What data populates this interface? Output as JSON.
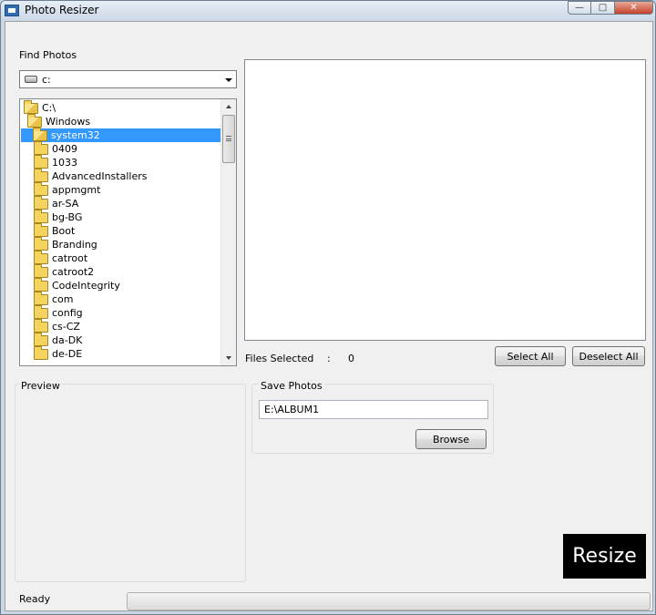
{
  "window": {
    "title": "Photo Resizer"
  },
  "find_photos": {
    "label": "Find Photos",
    "drive": "c:",
    "tree": [
      {
        "label": "C:\\",
        "level": 0,
        "open": true,
        "selected": false
      },
      {
        "label": "Windows",
        "level": 1,
        "open": true,
        "selected": false
      },
      {
        "label": "system32",
        "level": 2,
        "open": true,
        "selected": true
      },
      {
        "label": "0409",
        "level": 3,
        "open": false,
        "selected": false
      },
      {
        "label": "1033",
        "level": 3,
        "open": false,
        "selected": false
      },
      {
        "label": "AdvancedInstallers",
        "level": 3,
        "open": false,
        "selected": false
      },
      {
        "label": "appmgmt",
        "level": 3,
        "open": false,
        "selected": false
      },
      {
        "label": "ar-SA",
        "level": 3,
        "open": false,
        "selected": false
      },
      {
        "label": "bg-BG",
        "level": 3,
        "open": false,
        "selected": false
      },
      {
        "label": "Boot",
        "level": 3,
        "open": false,
        "selected": false
      },
      {
        "label": "Branding",
        "level": 3,
        "open": false,
        "selected": false
      },
      {
        "label": "catroot",
        "level": 3,
        "open": false,
        "selected": false
      },
      {
        "label": "catroot2",
        "level": 3,
        "open": false,
        "selected": false
      },
      {
        "label": "CodeIntegrity",
        "level": 3,
        "open": false,
        "selected": false
      },
      {
        "label": "com",
        "level": 3,
        "open": false,
        "selected": false
      },
      {
        "label": "config",
        "level": 3,
        "open": false,
        "selected": false
      },
      {
        "label": "cs-CZ",
        "level": 3,
        "open": false,
        "selected": false
      },
      {
        "label": "da-DK",
        "level": 3,
        "open": false,
        "selected": false
      },
      {
        "label": "de-DE",
        "level": 3,
        "open": false,
        "selected": false
      }
    ]
  },
  "files": {
    "selected_label": "Files Selected",
    "separator": ":",
    "count": "0",
    "select_all": "Select All",
    "deselect_all": "Deselect All"
  },
  "preview": {
    "label": "Preview"
  },
  "save_photos": {
    "label": "Save Photos",
    "path": "E:\\ALBUM1",
    "browse": "Browse"
  },
  "resize": {
    "label": "Resize"
  },
  "status": {
    "text": "Ready",
    "progress": 0
  }
}
